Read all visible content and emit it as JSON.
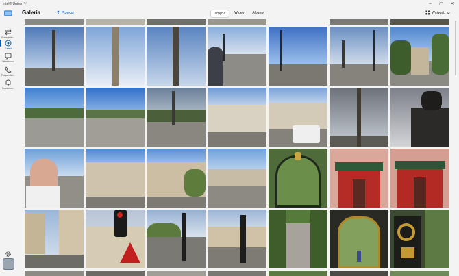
{
  "window": {
    "app_title": "Intel® Unison™",
    "controls": {
      "minimize": "–",
      "maximize": "▢",
      "close": "✕"
    }
  },
  "rail": {
    "items": [
      {
        "label": "Przesyłanie...",
        "icon": "transfer-icon"
      },
      {
        "label": "Galeria",
        "icon": "gallery-icon"
      },
      {
        "label": "Wiadomości",
        "icon": "messages-icon"
      },
      {
        "label": "Połączenia t...",
        "icon": "phone-icon"
      },
      {
        "label": "Powiadomi...",
        "icon": "bell-icon"
      }
    ],
    "settings_icon": "gear-icon",
    "profile_icon": "phone-profile-icon"
  },
  "header": {
    "title": "Galeria",
    "import_label": "Przekaż",
    "tabs": [
      {
        "label": "Zdjęcia",
        "active": true
      },
      {
        "label": "Wideo",
        "active": false
      },
      {
        "label": "Albumy",
        "active": false
      }
    ],
    "view_label": "Wyświetl"
  },
  "colors": {
    "accent": "#0b5cad",
    "background": "#f3f3f3"
  }
}
